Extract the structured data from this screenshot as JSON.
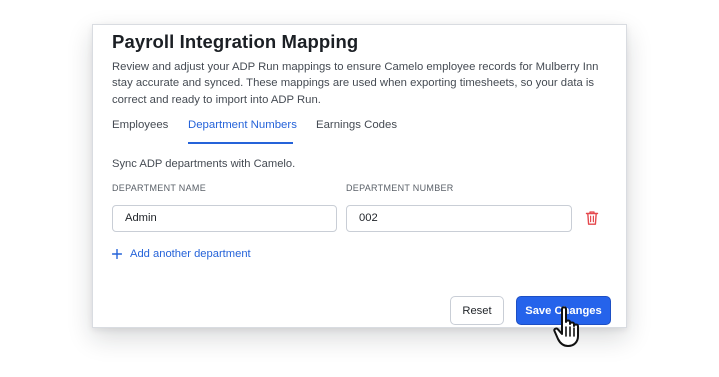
{
  "page": {
    "title": "Payroll Integration Mapping",
    "description": "Review and adjust your ADP Run mappings to ensure Camelo employee records for Mulberry Inn stay accurate and synced. These mappings are used when exporting timesheets, so your data is correct and ready to import into ADP Run."
  },
  "tabs": [
    {
      "label": "Employees",
      "active": false
    },
    {
      "label": "Department Numbers",
      "active": true
    },
    {
      "label": "Earnings Codes",
      "active": false
    }
  ],
  "departments": {
    "intro": "Sync ADP departments with Camelo.",
    "col_name_label": "DEPARTMENT NAME",
    "col_number_label": "DEPARTMENT NUMBER",
    "rows": [
      {
        "name": "Admin",
        "number": "002"
      }
    ],
    "add_label": "Add another department"
  },
  "actions": {
    "reset_label": "Reset",
    "save_label": "Save Changes"
  },
  "icons": {
    "delete": "trash-icon",
    "add": "plus-icon",
    "cursor": "hand-pointer-cursor"
  },
  "colors": {
    "accent": "#2563eb",
    "link": "#2563d9",
    "danger": "#e5484d"
  }
}
